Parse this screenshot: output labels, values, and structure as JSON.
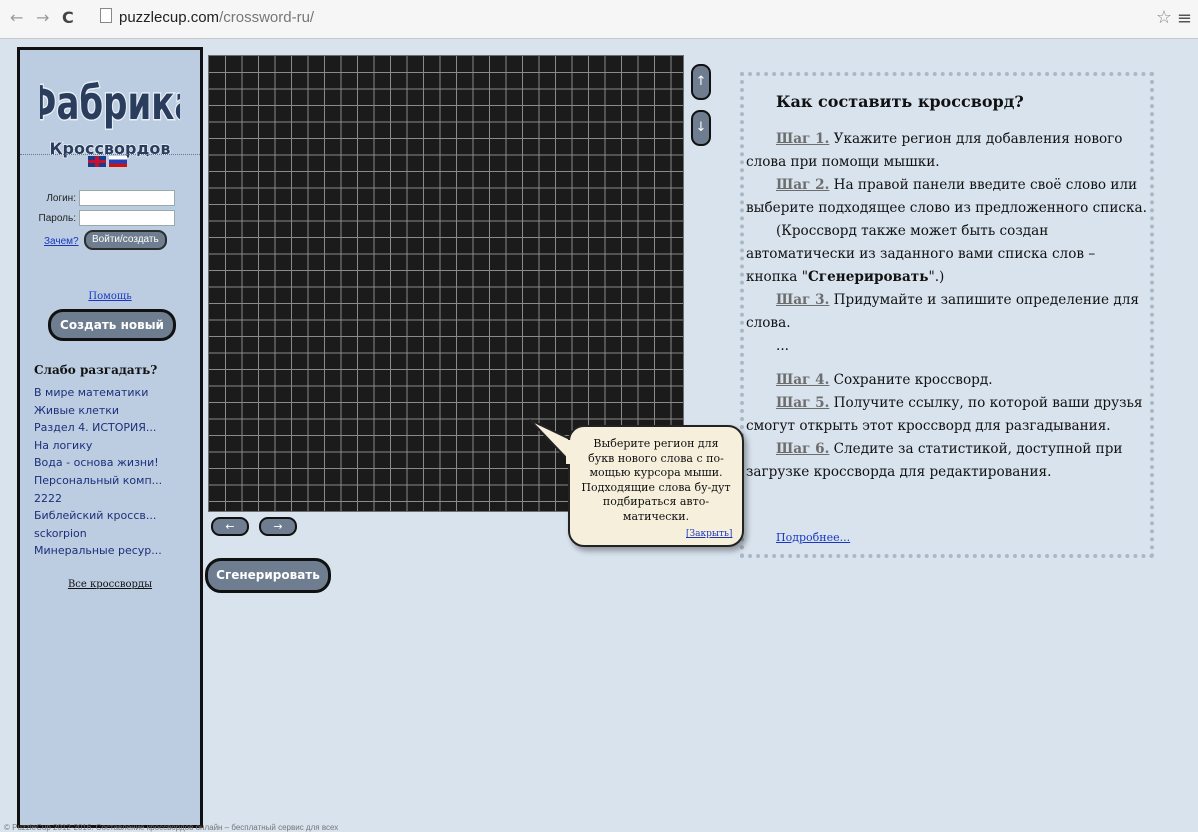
{
  "browser": {
    "back_icon": "←",
    "forward_icon": "→",
    "reload_icon": "C",
    "url_domain": "puzzlecup.com",
    "url_path": "/crossword-ru/",
    "star_icon": "☆",
    "menu_icon": "≡"
  },
  "sidebar": {
    "logo_line1": "Фабрика",
    "logo_line2": "Кроссвордов",
    "login_label": "Логин:",
    "password_label": "Пароль:",
    "login_value": "",
    "password_value": "",
    "why_link": "Зачем?",
    "login_button": "Войти/создать",
    "help_link": "Помощь",
    "create_button": "Создать новый",
    "weak_title": "Слабо разгадать?",
    "crosswords": [
      "В мире математики",
      "Живые клетки",
      "Раздел 4. ИСТОРИЯ...",
      "На логику",
      "Вода - основа жизни!",
      "Персональный комп...",
      "2222",
      "Библейский кроссв...",
      "sckorpion",
      "Минеральные ресур..."
    ],
    "all_link": "Все кроссворды"
  },
  "editor": {
    "up_arrow": "↑",
    "down_arrow": "↓",
    "left_arrow": "←",
    "right_arrow": "→",
    "generate_button": "Сгенерировать"
  },
  "howto": {
    "title": "Как составить кроссворд?",
    "step1_label": "Шаг 1.",
    "step1_text": " Укажите регион для добавления нового слова при помощи мышки.",
    "step2_label": "Шаг 2.",
    "step2_text": " На правой панели введите своё слово или выберите подходящее слово из предложенного списка.",
    "note_before": "(Кроссворд также может быть создан автоматически из заданного вами списка слов – кнопка \"",
    "note_bold": "Сгенерировать",
    "note_after": "\".)",
    "step3_label": "Шаг 3.",
    "step3_text": " Придумайте и запишите определение для слова.",
    "ellipsis": "...",
    "step4_label": "Шаг 4.",
    "step4_text": " Сохраните кроссворд.",
    "step5_label": "Шаг 5.",
    "step5_text": " Получите ссылку, по которой ваши друзья смогут открыть этот кроссворд для разгадывания.",
    "step6_label": "Шаг 6.",
    "step6_text": " Следите за статистикой, доступной при загрузке кроссворда для редактирования.",
    "more_link": "Подробнее..."
  },
  "tooltip": {
    "text": "Выберите регион для букв нового слова с по-мощью курсора мыши. Подходящие слова бу-дут подбираться авто-матически.",
    "close": "[Закрыть]"
  },
  "footer": {
    "text": "© PuzzleCup 2012-2016. Составление кроссвордов онлайн – бесплатный сервис для всех"
  },
  "colors": {
    "page_bg": "#d8e3ee",
    "sidebar_bg": "#bccde2",
    "grid_bg": "#1b1b1b",
    "button_bg": "#6e7d8f",
    "tooltip_bg": "#f5efdc"
  }
}
